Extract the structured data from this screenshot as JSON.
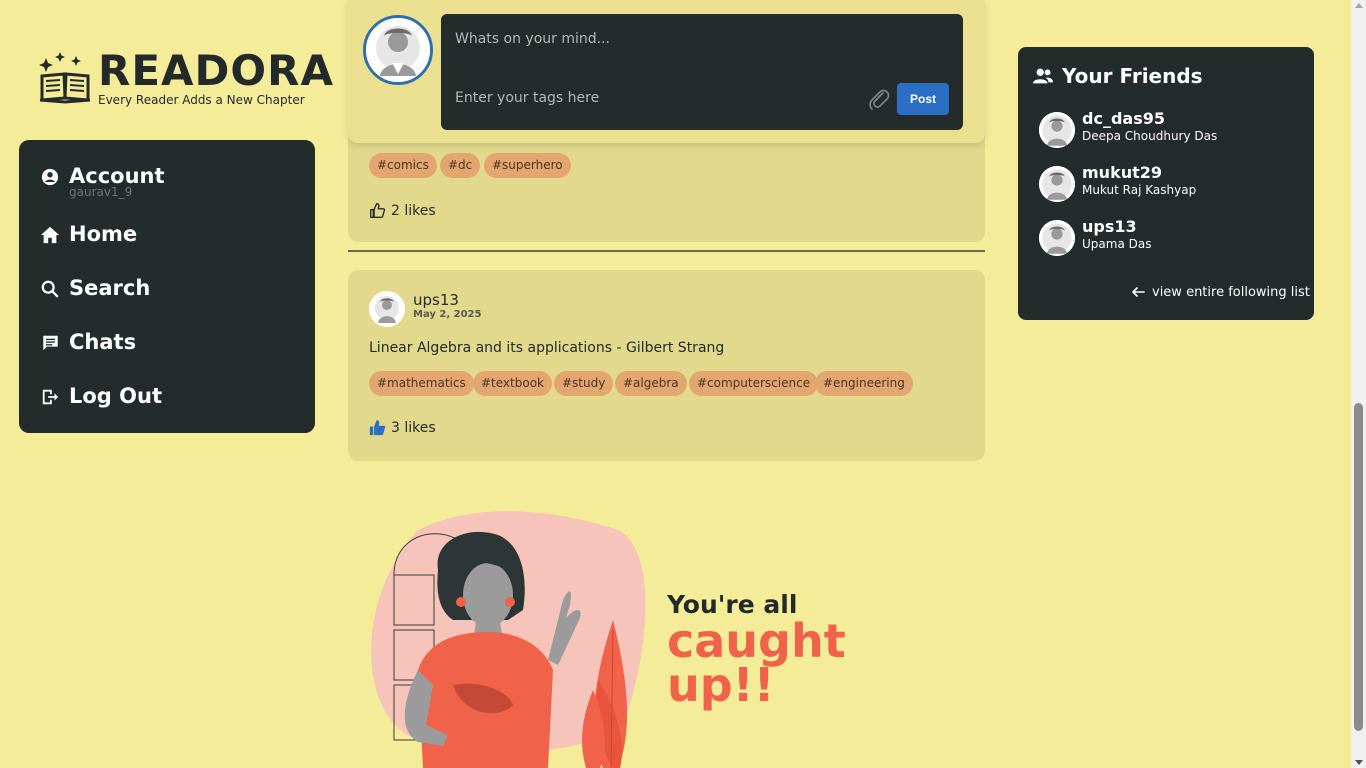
{
  "brand": {
    "title": "READORA",
    "tagline": "Every Reader Adds a New Chapter"
  },
  "nav": {
    "account_label": "Account",
    "account_user": "gaurav1_9",
    "home": "Home",
    "search": "Search",
    "chats": "Chats",
    "logout": "Log Out"
  },
  "composer": {
    "placeholder": "Whats on your mind...",
    "tags_placeholder": "Enter your tags here",
    "post_label": "Post"
  },
  "post1": {
    "tags": [
      "#comics",
      "#dc",
      "#superhero"
    ],
    "likes": "2 likes",
    "liked": false
  },
  "post2": {
    "username": "ups13",
    "date": "May 2, 2025",
    "text": "Linear Algebra and its applications - Gilbert Strang",
    "tags": [
      "#mathematics",
      "#textbook",
      "#study",
      "#algebra",
      "#computerscience",
      "#engineering"
    ],
    "likes": "3 likes",
    "liked": true
  },
  "friends": {
    "title": "Your Friends",
    "list": [
      {
        "username": "dc_das95",
        "name": "Deepa Choudhury Das"
      },
      {
        "username": "mukut29",
        "name": "Mukut Raj Kashyap"
      },
      {
        "username": "ups13",
        "name": "Upama Das"
      }
    ],
    "view_all": "view entire following list"
  },
  "caught_up": {
    "line1": "You're all ",
    "line2": "caught up!!"
  },
  "colors": {
    "background": "#f5ec9a",
    "panel": "#242b2b",
    "post_card": "#e2d98c",
    "tag_bg": "#e3a66e",
    "accent_blue": "#2a6fc4",
    "accent_coral": "#f0624a"
  }
}
